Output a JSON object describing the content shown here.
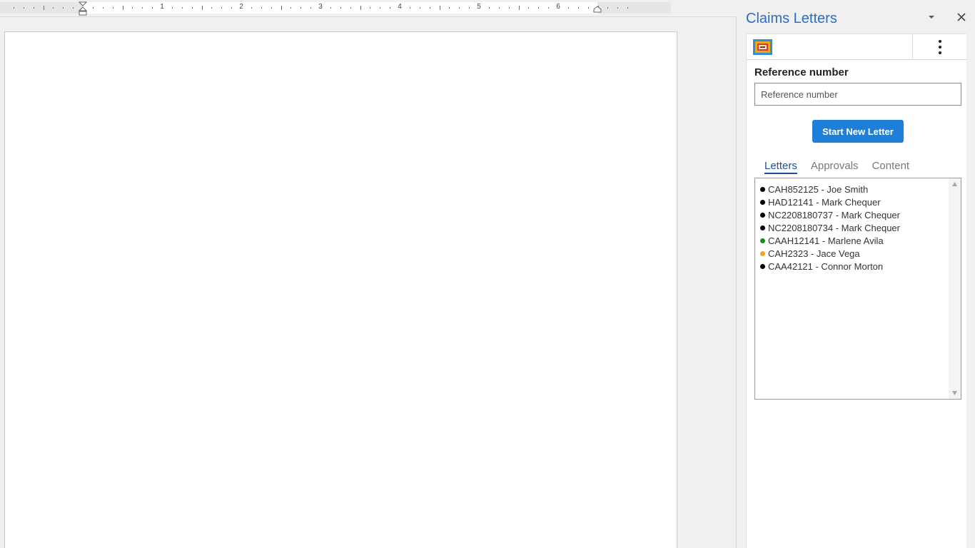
{
  "ruler": {
    "numbers": [
      "1",
      "2",
      "3",
      "4",
      "5",
      "6"
    ]
  },
  "pane": {
    "title": "Claims Letters"
  },
  "form": {
    "reference_label": "Reference number",
    "reference_placeholder": "Reference number",
    "reference_value": "",
    "start_button": "Start New Letter"
  },
  "tabs": [
    {
      "label": "Letters",
      "active": true
    },
    {
      "label": "Approvals",
      "active": false
    },
    {
      "label": "Content",
      "active": false
    }
  ],
  "letters": [
    {
      "text": "CAH852125 - Joe Smith",
      "status_color": "#000000"
    },
    {
      "text": "HAD12141 - Mark Chequer",
      "status_color": "#000000"
    },
    {
      "text": "NC2208180737 - Mark Chequer",
      "status_color": "#000000"
    },
    {
      "text": "NC2208180734 - Mark Chequer",
      "status_color": "#000000"
    },
    {
      "text": "CAAH12141 - Marlene Avila",
      "status_color": "#1a8a1a"
    },
    {
      "text": "CAH2323 - Jace Vega",
      "status_color": "#f5a623"
    },
    {
      "text": "CAA42121 - Connor Morton",
      "status_color": "#000000"
    }
  ],
  "icons": {
    "logo": "addin-logo-icon",
    "more": "more-vertical-icon",
    "dropdown": "chevron-down-icon",
    "close": "close-icon"
  },
  "colors": {
    "accent": "#1e7fd8",
    "title": "#2b6cc4",
    "tab_active": "#1f4f9a"
  }
}
